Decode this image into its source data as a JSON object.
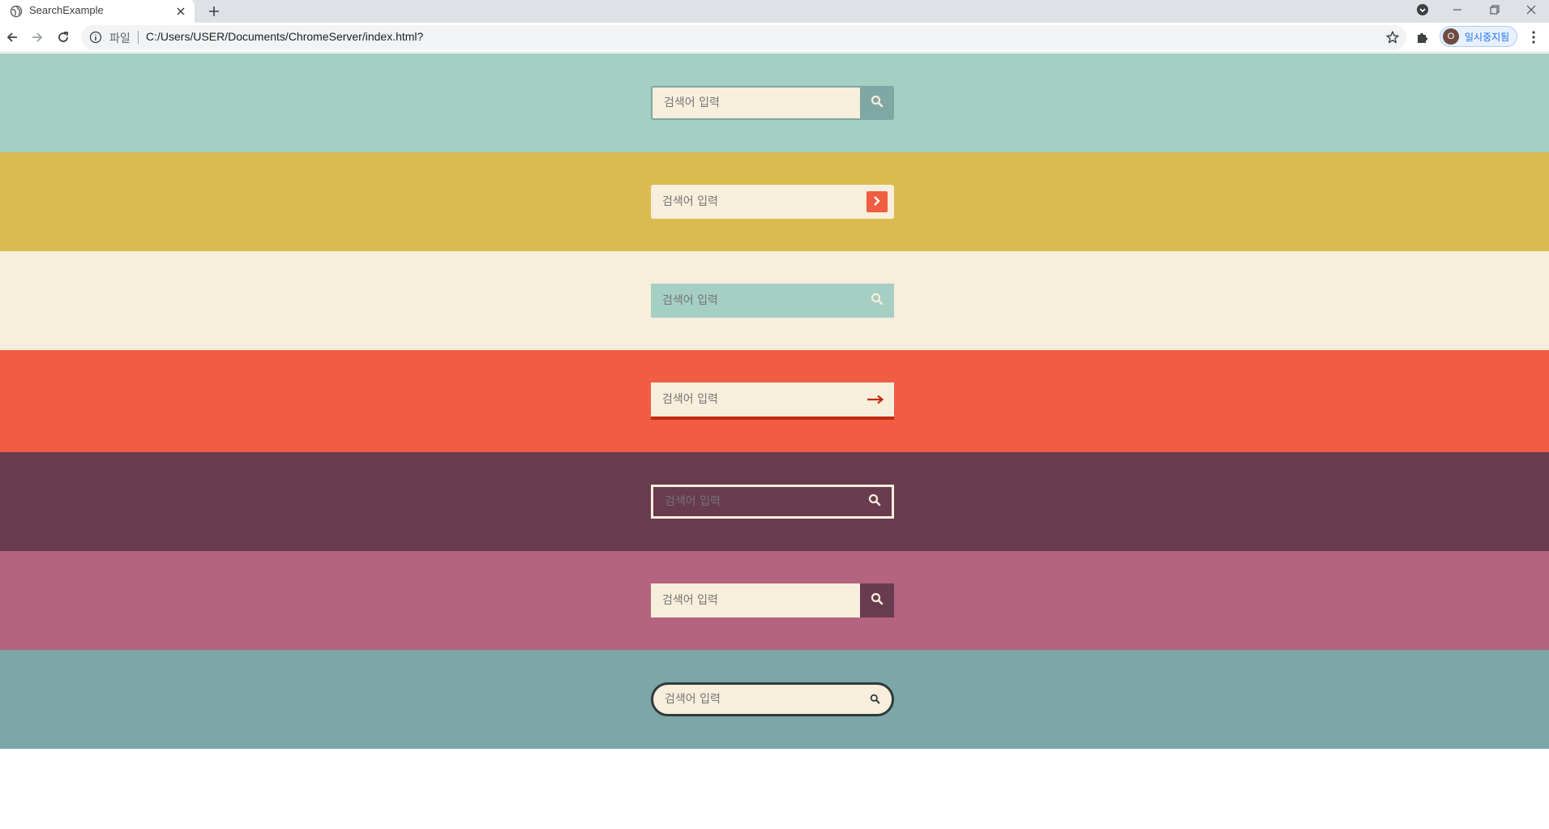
{
  "browser": {
    "tab_title": "SearchExample",
    "url_scheme": "파일",
    "url": "C:/Users/USER/Documents/ChromeServer/index.html?",
    "profile_initial": "O",
    "profile_label": "일시중지됨"
  },
  "colors": {
    "band1": "#a5cfc3",
    "band2": "#dbbb50",
    "band3": "#f7eedb",
    "band4": "#f05d42",
    "band5": "#683b4f",
    "band6": "#b4647e",
    "band7": "#7ca6a8",
    "cream": "#f7eedb"
  },
  "searches": [
    {
      "placeholder": "검색어 입력",
      "button_icon": "search-icon"
    },
    {
      "placeholder": "검색어 입력",
      "button_icon": "chevron-right-icon"
    },
    {
      "placeholder": "검색어 입력",
      "button_icon": "search-icon"
    },
    {
      "placeholder": "검색어 입력",
      "button_icon": "arrow-right-icon"
    },
    {
      "placeholder": "검색어 입력",
      "button_icon": "search-icon"
    },
    {
      "placeholder": "검색어 입력",
      "button_icon": "search-icon"
    },
    {
      "placeholder": "검색어 입력",
      "button_icon": "search-icon"
    }
  ]
}
